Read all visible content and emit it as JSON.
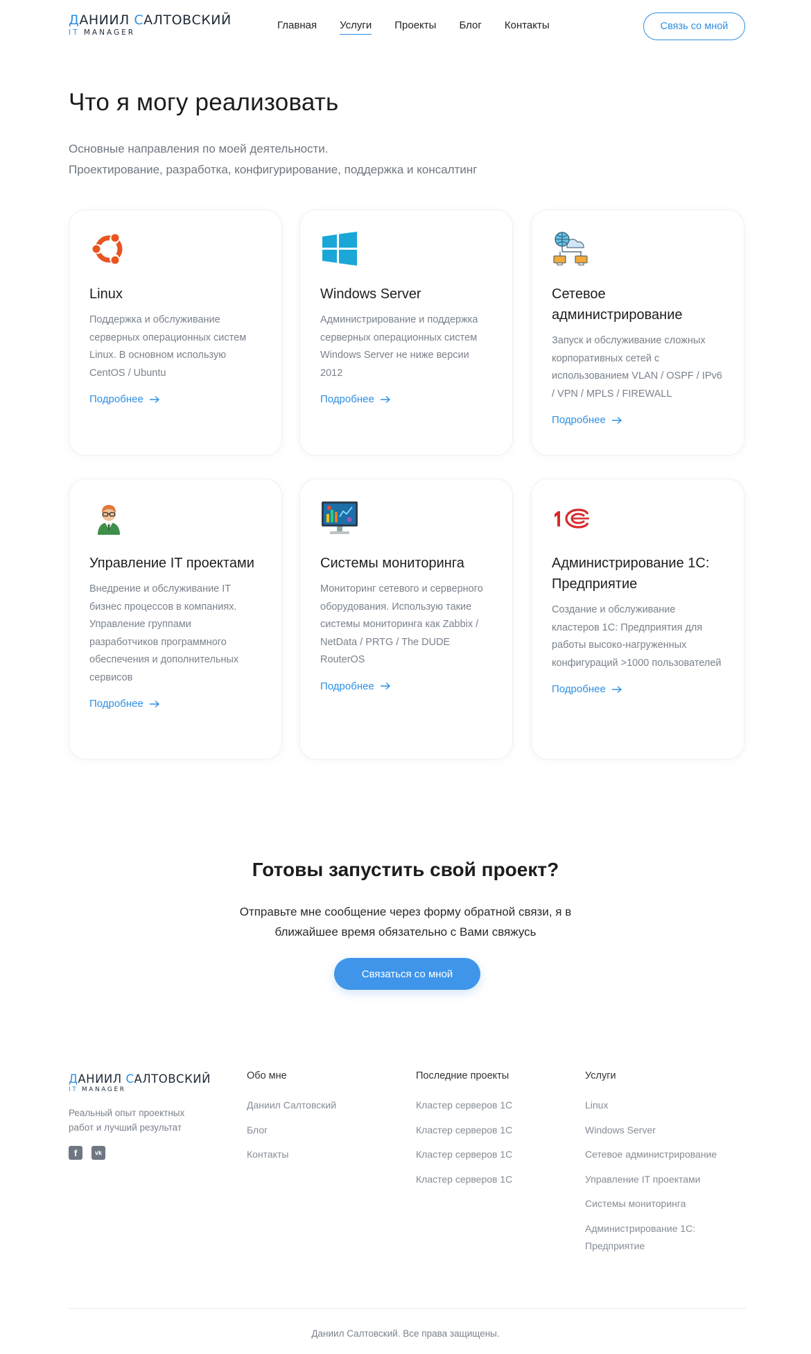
{
  "header": {
    "logo": {
      "name_accent_1": "Д",
      "name_part_1": "аниил ",
      "name_accent_2": "С",
      "name_part_2": "алтовский",
      "sub_accent": "IT",
      "sub_rest": " MANAGER"
    },
    "nav": [
      "Главная",
      "Услуги",
      "Проекты",
      "Блог",
      "Контакты"
    ],
    "active_nav": "Услуги",
    "contact_button": "Связь со мной"
  },
  "hero": {
    "title": "Что я могу реализовать",
    "subtitle_line_1": "Основные направления по моей деятельности.",
    "subtitle_line_2": "Проектирование, разработка, конфигурирование, поддержка и консалтинг"
  },
  "more_label": "Подробнее",
  "services": [
    {
      "icon": "ubuntu-icon",
      "title": "Linux",
      "text": "Поддержка и обслуживание серверных операционных систем Linux. В основном использую CentOS / Ubuntu"
    },
    {
      "icon": "windows-icon",
      "title": "Windows Server",
      "text": "Администрирование и поддержка серверных операционных систем Windows Server не ниже версии 2012"
    },
    {
      "icon": "network-cloud-icon",
      "title": "Сетевое администрирование",
      "text": "Запуск и обслуживание сложных корпоративных сетей с использованием VLAN / OSPF / IPv6 / VPN / MPLS / FIREWALL"
    },
    {
      "icon": "manager-person-icon",
      "title": "Управление IT проектами",
      "text": "Внедрение и обслуживание IT бизнес процессов в компаниях. Управление группами разработчиков программного обеспечения и дополнительных сервисов"
    },
    {
      "icon": "monitoring-screen-icon",
      "title": "Системы мониторинга",
      "text": "Мониторинг сетевого и серверного оборудования. Использую такие системы мониторинга как Zabbix / NetData / PRTG / The DUDE RouterOS"
    },
    {
      "icon": "1c-logo-icon",
      "title": "Администрирование 1С: Предприятие",
      "text": "Создание и обслуживание кластеров 1С: Предприятия для работы высоко-нагруженных конфигураций >1000 пользователей"
    }
  ],
  "cta": {
    "title": "Готовы запустить свой проект?",
    "text_line_1": "Отправьте мне сообщение через форму обратной связи, я в",
    "text_line_2": "ближайшее время обязательно с Вами свяжусь",
    "button": "Связаться со мной"
  },
  "footer": {
    "desc_line_1": "Реальный опыт проектных",
    "desc_line_2": "работ и лучший результат",
    "social": [
      "facebook-icon",
      "vk-icon"
    ],
    "columns": [
      {
        "title": "Обо мне",
        "links": [
          "Даниил Салтовский",
          "Блог",
          "Контакты"
        ]
      },
      {
        "title": "Последние проекты",
        "links": [
          "Кластер серверов 1С",
          "Кластер серверов 1С",
          "Кластер серверов 1С",
          "Кластер серверов 1С"
        ]
      },
      {
        "title": "Услуги",
        "links": [
          "Linux",
          "Windows Server",
          "Сетевое администрирование",
          "Управление IT проектами",
          "Системы мониторинга",
          "Администрирование 1С: Предприятие"
        ]
      }
    ],
    "copyright": "Даниил Салтовский. Все права защищены."
  },
  "colors": {
    "accent": "#2d8fe3",
    "cta_bg": "#3f95ea",
    "text_muted": "#7a828c",
    "ubuntu": "#e95420",
    "windows": "#1aa7d8",
    "onec_red": "#d52b2b"
  }
}
